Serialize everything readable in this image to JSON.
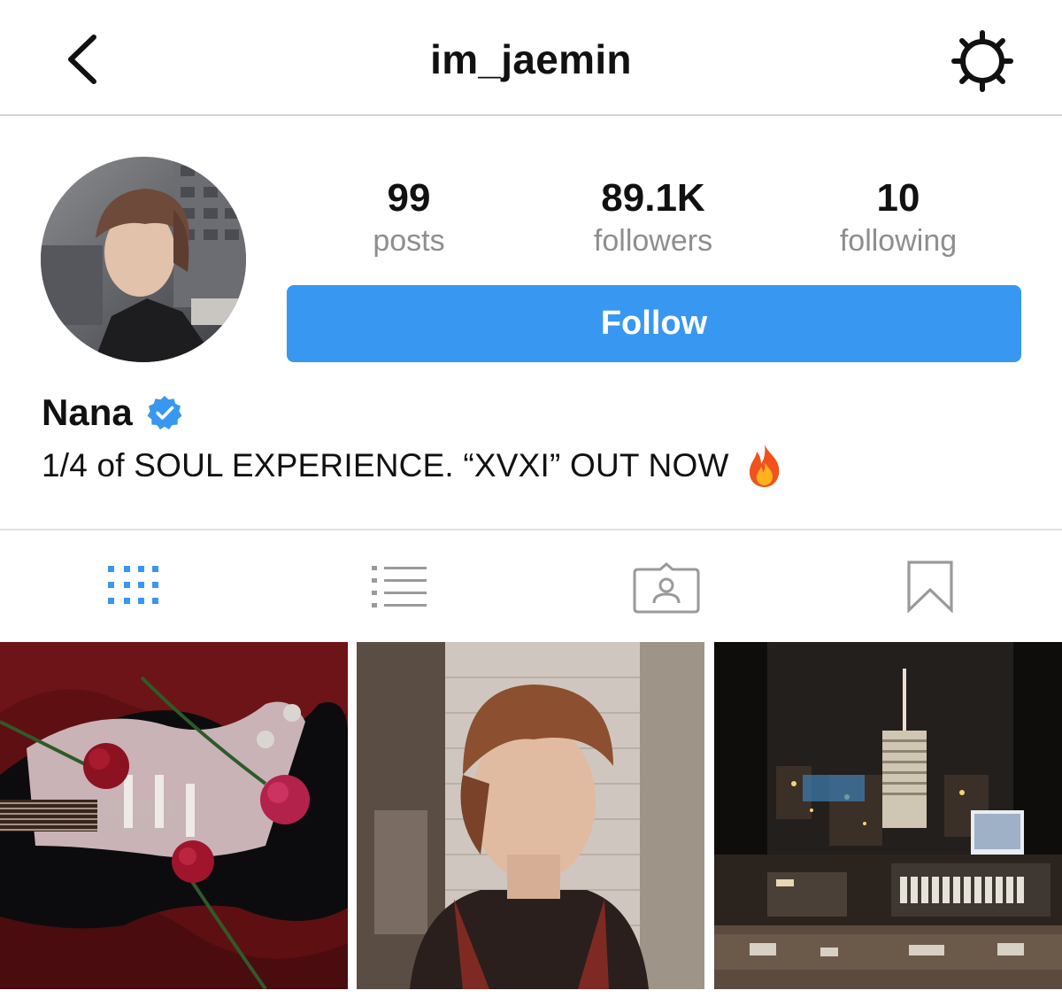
{
  "header": {
    "username": "im_jaemin"
  },
  "stats": {
    "posts": {
      "count": "99",
      "label": "posts"
    },
    "followers": {
      "count": "89.1K",
      "label": "followers"
    },
    "following": {
      "count": "10",
      "label": "following"
    }
  },
  "actions": {
    "follow_label": "Follow"
  },
  "profile": {
    "display_name": "Nana",
    "bio": "1/4 of SOUL EXPERIENCE. “XVXI” OUT NOW",
    "bio_emoji": "fire-emoji"
  },
  "tabs": [
    {
      "icon": "grid-icon",
      "active": true
    },
    {
      "icon": "list-icon",
      "active": false
    },
    {
      "icon": "tagged-icon",
      "active": false
    },
    {
      "icon": "bookmark-icon",
      "active": false
    }
  ],
  "colors": {
    "accent": "#3897f0",
    "text": "#111111",
    "muted": "#8e8e8e",
    "tab_inactive": "#9a9a9a",
    "divider": "#d4d4d4"
  }
}
